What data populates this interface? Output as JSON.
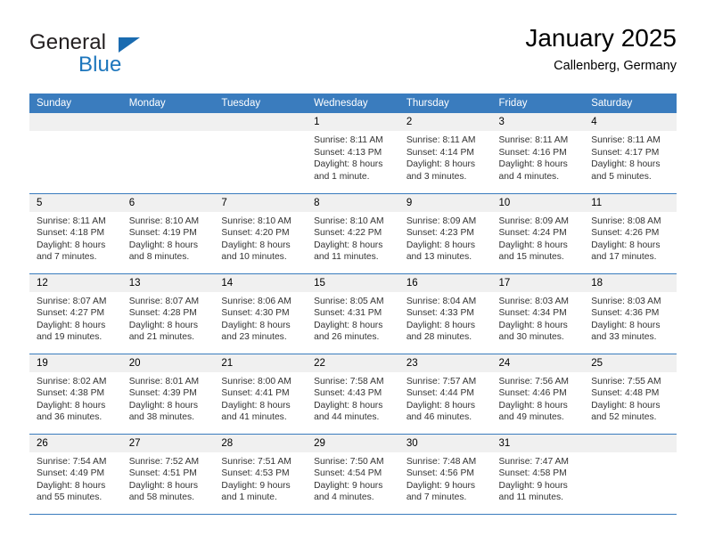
{
  "brand": {
    "name_top": "General",
    "name_bottom": "Blue",
    "triangle_icon": "triangle-icon",
    "accent_color": "#1d76bc"
  },
  "header": {
    "title": "January 2025",
    "subtitle": "Callenberg, Germany"
  },
  "theme": {
    "header_bar": "#3a7cbe",
    "daynum_band": "#f0f0f0",
    "text": "#333333"
  },
  "weekday_headers": [
    "Sunday",
    "Monday",
    "Tuesday",
    "Wednesday",
    "Thursday",
    "Friday",
    "Saturday"
  ],
  "weeks": [
    [
      {
        "day": "",
        "lines": []
      },
      {
        "day": "",
        "lines": []
      },
      {
        "day": "",
        "lines": []
      },
      {
        "day": "1",
        "lines": [
          "Sunrise: 8:11 AM",
          "Sunset: 4:13 PM",
          "Daylight: 8 hours",
          "and 1 minute."
        ]
      },
      {
        "day": "2",
        "lines": [
          "Sunrise: 8:11 AM",
          "Sunset: 4:14 PM",
          "Daylight: 8 hours",
          "and 3 minutes."
        ]
      },
      {
        "day": "3",
        "lines": [
          "Sunrise: 8:11 AM",
          "Sunset: 4:16 PM",
          "Daylight: 8 hours",
          "and 4 minutes."
        ]
      },
      {
        "day": "4",
        "lines": [
          "Sunrise: 8:11 AM",
          "Sunset: 4:17 PM",
          "Daylight: 8 hours",
          "and 5 minutes."
        ]
      }
    ],
    [
      {
        "day": "5",
        "lines": [
          "Sunrise: 8:11 AM",
          "Sunset: 4:18 PM",
          "Daylight: 8 hours",
          "and 7 minutes."
        ]
      },
      {
        "day": "6",
        "lines": [
          "Sunrise: 8:10 AM",
          "Sunset: 4:19 PM",
          "Daylight: 8 hours",
          "and 8 minutes."
        ]
      },
      {
        "day": "7",
        "lines": [
          "Sunrise: 8:10 AM",
          "Sunset: 4:20 PM",
          "Daylight: 8 hours",
          "and 10 minutes."
        ]
      },
      {
        "day": "8",
        "lines": [
          "Sunrise: 8:10 AM",
          "Sunset: 4:22 PM",
          "Daylight: 8 hours",
          "and 11 minutes."
        ]
      },
      {
        "day": "9",
        "lines": [
          "Sunrise: 8:09 AM",
          "Sunset: 4:23 PM",
          "Daylight: 8 hours",
          "and 13 minutes."
        ]
      },
      {
        "day": "10",
        "lines": [
          "Sunrise: 8:09 AM",
          "Sunset: 4:24 PM",
          "Daylight: 8 hours",
          "and 15 minutes."
        ]
      },
      {
        "day": "11",
        "lines": [
          "Sunrise: 8:08 AM",
          "Sunset: 4:26 PM",
          "Daylight: 8 hours",
          "and 17 minutes."
        ]
      }
    ],
    [
      {
        "day": "12",
        "lines": [
          "Sunrise: 8:07 AM",
          "Sunset: 4:27 PM",
          "Daylight: 8 hours",
          "and 19 minutes."
        ]
      },
      {
        "day": "13",
        "lines": [
          "Sunrise: 8:07 AM",
          "Sunset: 4:28 PM",
          "Daylight: 8 hours",
          "and 21 minutes."
        ]
      },
      {
        "day": "14",
        "lines": [
          "Sunrise: 8:06 AM",
          "Sunset: 4:30 PM",
          "Daylight: 8 hours",
          "and 23 minutes."
        ]
      },
      {
        "day": "15",
        "lines": [
          "Sunrise: 8:05 AM",
          "Sunset: 4:31 PM",
          "Daylight: 8 hours",
          "and 26 minutes."
        ]
      },
      {
        "day": "16",
        "lines": [
          "Sunrise: 8:04 AM",
          "Sunset: 4:33 PM",
          "Daylight: 8 hours",
          "and 28 minutes."
        ]
      },
      {
        "day": "17",
        "lines": [
          "Sunrise: 8:03 AM",
          "Sunset: 4:34 PM",
          "Daylight: 8 hours",
          "and 30 minutes."
        ]
      },
      {
        "day": "18",
        "lines": [
          "Sunrise: 8:03 AM",
          "Sunset: 4:36 PM",
          "Daylight: 8 hours",
          "and 33 minutes."
        ]
      }
    ],
    [
      {
        "day": "19",
        "lines": [
          "Sunrise: 8:02 AM",
          "Sunset: 4:38 PM",
          "Daylight: 8 hours",
          "and 36 minutes."
        ]
      },
      {
        "day": "20",
        "lines": [
          "Sunrise: 8:01 AM",
          "Sunset: 4:39 PM",
          "Daylight: 8 hours",
          "and 38 minutes."
        ]
      },
      {
        "day": "21",
        "lines": [
          "Sunrise: 8:00 AM",
          "Sunset: 4:41 PM",
          "Daylight: 8 hours",
          "and 41 minutes."
        ]
      },
      {
        "day": "22",
        "lines": [
          "Sunrise: 7:58 AM",
          "Sunset: 4:43 PM",
          "Daylight: 8 hours",
          "and 44 minutes."
        ]
      },
      {
        "day": "23",
        "lines": [
          "Sunrise: 7:57 AM",
          "Sunset: 4:44 PM",
          "Daylight: 8 hours",
          "and 46 minutes."
        ]
      },
      {
        "day": "24",
        "lines": [
          "Sunrise: 7:56 AM",
          "Sunset: 4:46 PM",
          "Daylight: 8 hours",
          "and 49 minutes."
        ]
      },
      {
        "day": "25",
        "lines": [
          "Sunrise: 7:55 AM",
          "Sunset: 4:48 PM",
          "Daylight: 8 hours",
          "and 52 minutes."
        ]
      }
    ],
    [
      {
        "day": "26",
        "lines": [
          "Sunrise: 7:54 AM",
          "Sunset: 4:49 PM",
          "Daylight: 8 hours",
          "and 55 minutes."
        ]
      },
      {
        "day": "27",
        "lines": [
          "Sunrise: 7:52 AM",
          "Sunset: 4:51 PM",
          "Daylight: 8 hours",
          "and 58 minutes."
        ]
      },
      {
        "day": "28",
        "lines": [
          "Sunrise: 7:51 AM",
          "Sunset: 4:53 PM",
          "Daylight: 9 hours",
          "and 1 minute."
        ]
      },
      {
        "day": "29",
        "lines": [
          "Sunrise: 7:50 AM",
          "Sunset: 4:54 PM",
          "Daylight: 9 hours",
          "and 4 minutes."
        ]
      },
      {
        "day": "30",
        "lines": [
          "Sunrise: 7:48 AM",
          "Sunset: 4:56 PM",
          "Daylight: 9 hours",
          "and 7 minutes."
        ]
      },
      {
        "day": "31",
        "lines": [
          "Sunrise: 7:47 AM",
          "Sunset: 4:58 PM",
          "Daylight: 9 hours",
          "and 11 minutes."
        ]
      },
      {
        "day": "",
        "lines": []
      }
    ]
  ]
}
